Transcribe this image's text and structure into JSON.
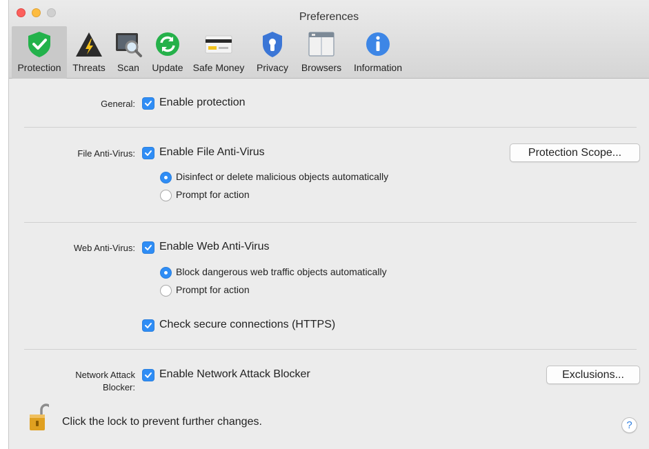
{
  "window": {
    "title": "Preferences"
  },
  "toolbar": {
    "items": [
      {
        "label": "Protection",
        "icon": "shield-check-icon"
      },
      {
        "label": "Threats",
        "icon": "warning-triangle-icon"
      },
      {
        "label": "Scan",
        "icon": "scan-magnifier-icon"
      },
      {
        "label": "Update",
        "icon": "update-refresh-icon"
      },
      {
        "label": "Safe Money",
        "icon": "credit-card-icon"
      },
      {
        "label": "Privacy",
        "icon": "privacy-shield-icon"
      },
      {
        "label": "Browsers",
        "icon": "browser-window-icon"
      },
      {
        "label": "Information",
        "icon": "info-icon"
      }
    ],
    "selected": "Protection"
  },
  "general": {
    "label": "General:",
    "enable_label": "Enable protection",
    "checked": true
  },
  "file_av": {
    "label": "File Anti-Virus:",
    "enable_label": "Enable File Anti-Virus",
    "checked": true,
    "scope_button": "Protection Scope...",
    "option_auto": "Disinfect or delete malicious objects automatically",
    "option_prompt": "Prompt for action",
    "selected_option": "auto"
  },
  "web_av": {
    "label": "Web Anti-Virus:",
    "enable_label": "Enable Web Anti-Virus",
    "checked": true,
    "option_auto": "Block dangerous web traffic objects automatically",
    "option_prompt": "Prompt for action",
    "selected_option": "auto",
    "https_label": "Check secure connections (HTTPS)",
    "https_checked": true
  },
  "network": {
    "label_line1": "Network Attack",
    "label_line2": "Blocker:",
    "enable_label": "Enable Network Attack Blocker",
    "checked": true,
    "exclusions_button": "Exclusions..."
  },
  "footer": {
    "lock_text": "Click the lock to prevent further changes.",
    "help_symbol": "?"
  },
  "colors": {
    "accent": "#2f8df5",
    "shield_green": "#23b24b",
    "lock_gold": "#e0a020"
  }
}
